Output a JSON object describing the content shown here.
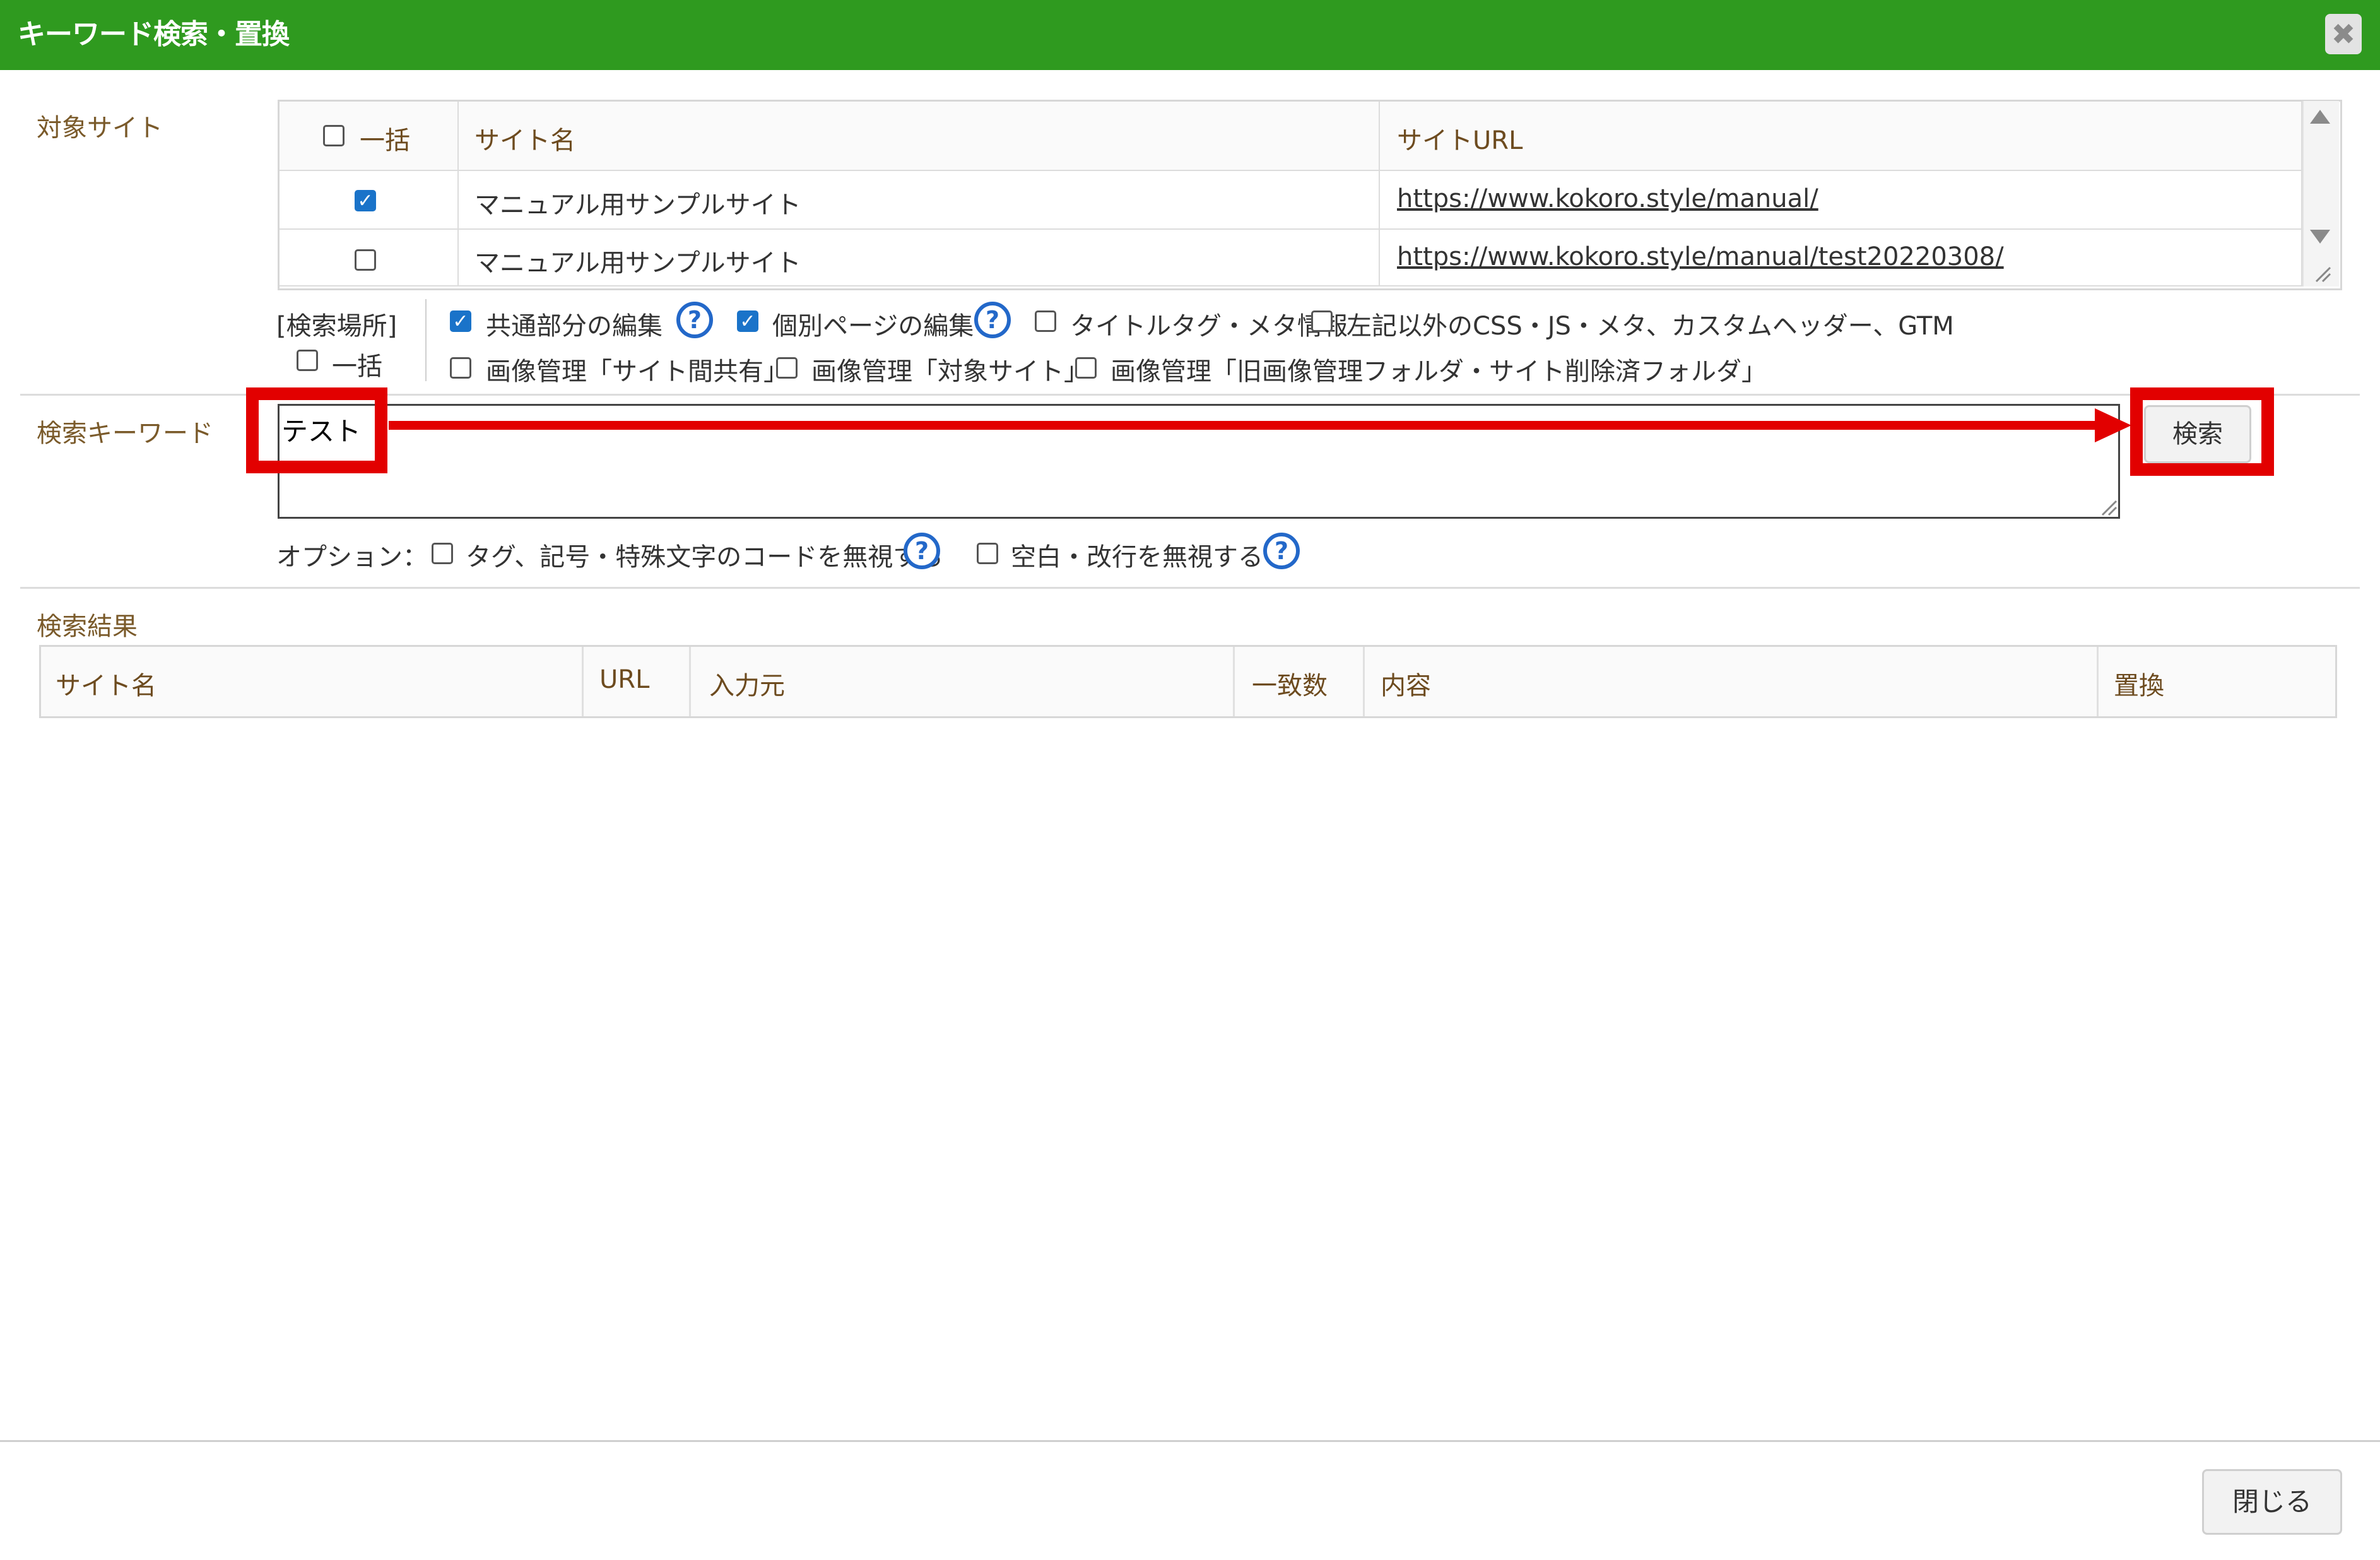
{
  "dialog": {
    "title": "キーワード検索・置換",
    "close_icon_glyph": "✖"
  },
  "target_site": {
    "label": "対象サイト",
    "table": {
      "headers": {
        "bulk": "一括",
        "site_name": "サイト名",
        "site_url": "サイトURL"
      },
      "rows": [
        {
          "checked": true,
          "site_name": "マニュアル用サンプルサイト",
          "url": "https://www.kokoro.style/manual/"
        },
        {
          "checked": false,
          "site_name": "マニュアル用サンプルサイト",
          "url": "https://www.kokoro.style/manual/test20220308/"
        }
      ]
    }
  },
  "search_location": {
    "label": "[検索場所]",
    "bulk_label": "一括",
    "options_row1": [
      {
        "label": "共通部分の編集",
        "checked": true,
        "help": true
      },
      {
        "label": "個別ページの編集",
        "checked": true,
        "help": true
      },
      {
        "label": "タイトルタグ・メタ情報",
        "checked": false,
        "help": false
      },
      {
        "label": "左記以外のCSS・JS・メタ、カスタムヘッダー、GTM",
        "checked": false,
        "help": false
      }
    ],
    "options_row2": [
      {
        "label": "画像管理「サイト間共有」",
        "checked": false
      },
      {
        "label": "画像管理「対象サイト」",
        "checked": false
      },
      {
        "label": "画像管理「旧画像管理フォルダ・サイト削除済フォルダ」",
        "checked": false
      }
    ]
  },
  "keyword": {
    "label": "検索キーワード",
    "value": "テスト",
    "search_button": "検索"
  },
  "options": {
    "label": "オプション：",
    "items": [
      {
        "label": "タグ、記号・特殊文字のコードを無視する",
        "checked": false
      },
      {
        "label": "空白・改行を無視する",
        "checked": false
      }
    ]
  },
  "results": {
    "label": "検索結果",
    "columns": [
      "サイト名",
      "URL",
      "入力元",
      "一致数",
      "内容",
      "置換"
    ]
  },
  "footer": {
    "close_button": "閉じる"
  },
  "colors": {
    "titlebar": "#2f9a1f",
    "highlight": "#e20000",
    "check": "#1a73c9",
    "help": "#2368c9",
    "label": "#7a5a2a"
  },
  "icons": {
    "check": "✓",
    "help": "?"
  }
}
